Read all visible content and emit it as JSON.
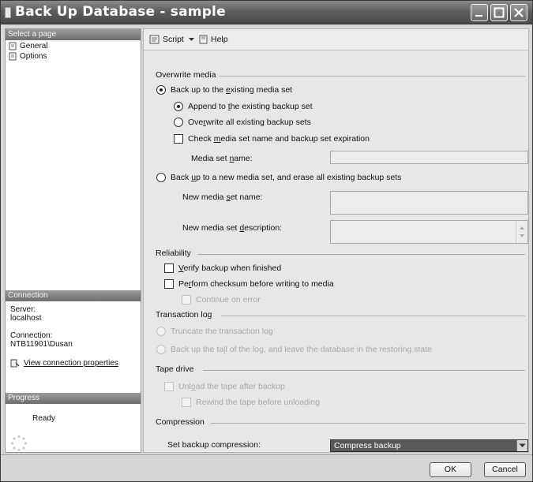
{
  "window": {
    "title": "Back Up Database - sample"
  },
  "left": {
    "select_page_header": "Select a page",
    "pages": [
      {
        "label": "General"
      },
      {
        "label": "Options"
      }
    ],
    "connection_header": "Connection",
    "server_label": "Server:",
    "server_value": "localhost",
    "connection_label": "Connection:",
    "connection_value": "NTB11901\\Dusan",
    "view_props_link": "View connection properties",
    "progress_header": "Progress",
    "progress_status": "Ready"
  },
  "toolbar": {
    "script_label": "Script",
    "help_label": "Help"
  },
  "overwrite": {
    "title": "Overwrite media",
    "existing_pre": "Back up to the ",
    "existing_key": "e",
    "existing_post": "xisting media set",
    "append_pre": "Append to ",
    "append_key": "t",
    "append_post": "he existing backup set",
    "overwrite_pre": "Ove",
    "overwrite_key": "r",
    "overwrite_post": "write all existing backup sets",
    "check_pre": "Check ",
    "check_key": "m",
    "check_post": "edia set name and backup set expiration",
    "media_name_pre": "Media set ",
    "media_name_key": "n",
    "media_name_post": "ame:",
    "new_pre": "Back ",
    "new_key": "u",
    "new_post": "p to a new media set, and erase all existing backup sets",
    "new_name_pre": "New media ",
    "new_name_key": "s",
    "new_name_post": "et name:",
    "new_desc_pre": "New media set ",
    "new_desc_key": "d",
    "new_desc_post": "escription:"
  },
  "reliability": {
    "title": "Reliability",
    "verify_key": "V",
    "verify_post": "erify backup when finished",
    "checksum_pre": "Pe",
    "checksum_key": "r",
    "checksum_post": "form checksum before writing to media",
    "continue_label": "Continue on error"
  },
  "translog": {
    "title": "Transaction log",
    "truncate_label": "Truncate the transaction log",
    "tail_pre": "Back up the ta",
    "tail_key": "i",
    "tail_post": "l of the log, and leave the database in the restoring state"
  },
  "tape": {
    "title": "Tape drive",
    "unload_pre": "Unl",
    "unload_key": "o",
    "unload_post": "ad the tape after backup",
    "rewind_label": "Rewind the tape before unloading"
  },
  "compression": {
    "title": "Compression",
    "set_label": "Set backup compression:",
    "selected": "Compress backup"
  },
  "buttons": {
    "ok": "OK",
    "cancel": "Cancel"
  }
}
